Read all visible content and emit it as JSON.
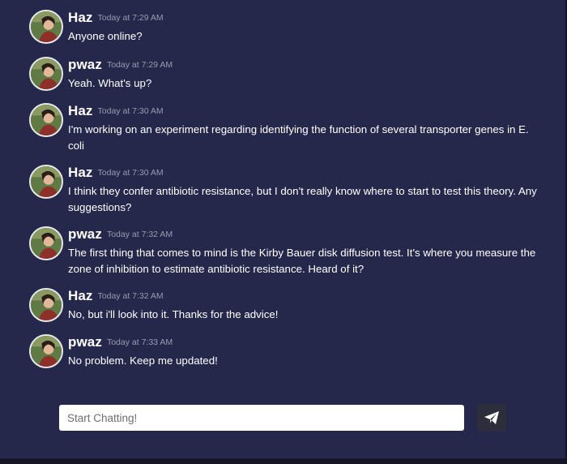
{
  "messages": [
    {
      "name": "Haz",
      "time": "Today at 7:29 AM",
      "text": "Anyone online?"
    },
    {
      "name": "pwaz",
      "time": "Today at 7:29 AM",
      "text": "Yeah. What's up?"
    },
    {
      "name": "Haz",
      "time": "Today at 7:30 AM",
      "text": "I'm working on an experiment regarding identifying the function of several transporter genes in E. coli"
    },
    {
      "name": "Haz",
      "time": "Today at 7:30 AM",
      "text": "I think they confer antibiotic resistance, but I don't really know where to start to test this theory. Any suggestions?"
    },
    {
      "name": "pwaz",
      "time": "Today at 7:32 AM",
      "text": "The first thing that comes to mind is the Kirby Bauer disk diffusion test. It's where you measure the zone of inhibition to estimate antibiotic resistance. Heard of it?"
    },
    {
      "name": "Haz",
      "time": "Today at 7:32 AM",
      "text": "No, but i'll look into it. Thanks for the advice!"
    },
    {
      "name": "pwaz",
      "time": "Today at 7:33 AM",
      "text": "No problem. Keep me updated!"
    }
  ],
  "composer": {
    "placeholder": "Start Chatting!",
    "value": "",
    "send_icon": "paper-plane-icon"
  },
  "colors": {
    "background": "#25284a",
    "text": "#ffffff",
    "timestamp": "#9a9bb0",
    "send_button": "#2c2e3c"
  }
}
